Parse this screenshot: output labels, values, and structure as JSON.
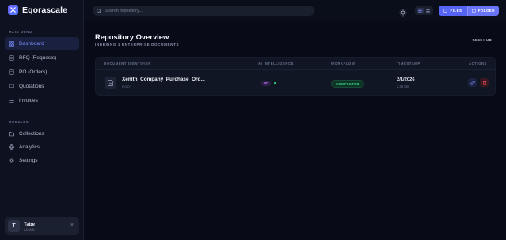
{
  "brand": {
    "name": "Eqorascale"
  },
  "sidebar": {
    "main_menu_label": "MAIN MENU",
    "modules_label": "MODULES",
    "main_items": [
      {
        "label": "Dashboard",
        "icon": "grid-icon",
        "active": true
      },
      {
        "label": "RFQ (Requests)",
        "icon": "document-icon"
      },
      {
        "label": "PO (Orders)",
        "icon": "document-icon"
      },
      {
        "label": "Quotations",
        "icon": "message-icon"
      },
      {
        "label": "Invoices",
        "icon": "list-icon"
      }
    ],
    "module_items": [
      {
        "label": "Collections",
        "icon": "folder-icon"
      },
      {
        "label": "Analytics",
        "icon": "globe-icon"
      },
      {
        "label": "Settings",
        "icon": "gear-icon"
      }
    ],
    "user": {
      "initial": "T",
      "name": "Tabe",
      "role": "ADMIN"
    }
  },
  "topbar": {
    "search_placeholder": "Search repository...",
    "files_label": "FILES",
    "folder_label": "FOLDER"
  },
  "main": {
    "title": "Repository Overview",
    "subtitle": "INDEXING 1 ENTERPRISE DOCUMENTS",
    "reset_label": "RESET DB",
    "table": {
      "columns": [
        "DOCUMENT IDENTIFIER",
        "AI INTELLIGENCE",
        "WORKFLOW",
        "TIMESTAMP",
        "ACTIONS"
      ],
      "rows": [
        {
          "name": "Xenith_Company_Purchase_Ord...",
          "sub": "ROOT",
          "tag": "PO",
          "status": "COMPLETED",
          "date": "2/1/2026",
          "size": "2.38 KB"
        }
      ]
    }
  },
  "colors": {
    "accent": "#5664f5",
    "success": "#35d68a",
    "danger": "#e0485a",
    "po": "#c07bff"
  }
}
